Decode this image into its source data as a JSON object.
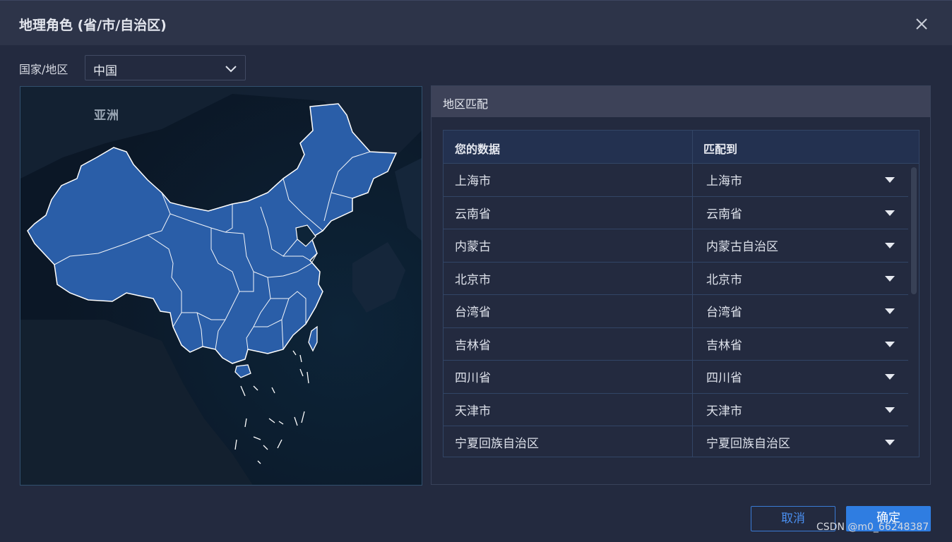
{
  "dialog": {
    "title": "地理角色 (省/市/自治区)",
    "close_icon": "close-icon"
  },
  "country": {
    "label": "国家/地区",
    "selected": "中国"
  },
  "map": {
    "continent_label": "亚洲",
    "region_fill": "#2a5ea8",
    "border_color": "#ffffff",
    "background": "#0e1b2c"
  },
  "match_panel": {
    "title": "地区匹配",
    "columns": [
      "您的数据",
      "匹配到"
    ],
    "rows": [
      {
        "data": "上海市",
        "match": "上海市"
      },
      {
        "data": "云南省",
        "match": "云南省"
      },
      {
        "data": "内蒙古",
        "match": "内蒙古自治区"
      },
      {
        "data": "北京市",
        "match": "北京市"
      },
      {
        "data": "台湾省",
        "match": "台湾省"
      },
      {
        "data": "吉林省",
        "match": "吉林省"
      },
      {
        "data": "四川省",
        "match": "四川省"
      },
      {
        "data": "天津市",
        "match": "天津市"
      },
      {
        "data": "宁夏回族自治区",
        "match": "宁夏回族自治区"
      }
    ]
  },
  "buttons": {
    "cancel": "取消",
    "ok": "确定"
  },
  "watermark": "CSDN @m0_66248387",
  "colors": {
    "primary": "#2f7de1",
    "dialog_bg": "#232a3f",
    "header_bg": "#2d3449"
  }
}
